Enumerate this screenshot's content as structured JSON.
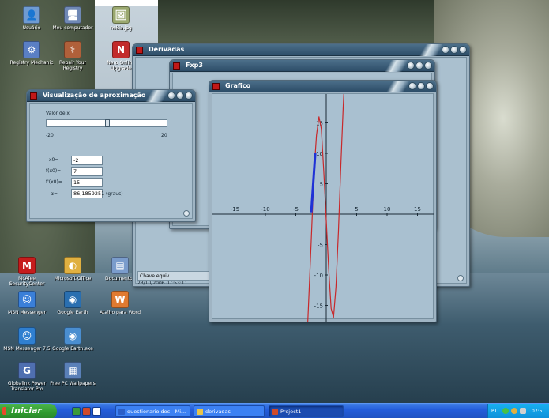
{
  "desktop": {
    "icons": [
      {
        "label": "Usuário",
        "color": "#6f9bd1",
        "glyph": "👤"
      },
      {
        "label": "Meu computador",
        "color": "#6f88b5",
        "glyph": "🖥"
      },
      {
        "label": "nokia.jpg",
        "color": "#9aa86f",
        "glyph": "🖼"
      },
      {
        "label": "Registry Mechanic",
        "color": "#5a7fc4",
        "glyph": "⚙"
      },
      {
        "label": "Repair Your Registry",
        "color": "#b0603a",
        "glyph": "⚕"
      },
      {
        "label": "Nero Online Upgrade",
        "color": "#c22a2a",
        "glyph": "N"
      },
      {
        "label": "McAfee SecurityCenter",
        "color": "#c61c1c",
        "glyph": "M"
      },
      {
        "label": "Microsoft Office",
        "color": "#e0b040",
        "glyph": "◐"
      },
      {
        "label": "Documentos",
        "color": "#7a9ccc",
        "glyph": "▤"
      },
      {
        "label": "MSN Messenger",
        "color": "#3a7fd8",
        "glyph": "☺"
      },
      {
        "label": "Google Earth",
        "color": "#2a6fb0",
        "glyph": "◉"
      },
      {
        "label": "Atalho para Word",
        "color": "#e07a30",
        "glyph": "W"
      },
      {
        "label": "MSN Messenger 7.5",
        "color": "#2f7fd0",
        "glyph": "☺"
      },
      {
        "label": "Google Earth.exe",
        "color": "#4a8ed0",
        "glyph": "◉"
      },
      {
        "label": "Globalink Power Translator Pro",
        "color": "#4f6fb0",
        "glyph": "G"
      },
      {
        "label": "Free PC Wallpapers",
        "color": "#5a80b8",
        "glyph": "▦"
      }
    ]
  },
  "windows": {
    "derivadas": {
      "title": "Derivadas"
    },
    "fxp3": {
      "title": "Fxp3"
    },
    "visualizacao": {
      "title": "Visualização de aproximação",
      "slider_caption": "Valor de x",
      "slider_min": "-20",
      "slider_max": "20",
      "slider_value": 0.5,
      "fields": [
        {
          "label": "x0=",
          "value": "-2"
        },
        {
          "label": "f(x0)=",
          "value": "7"
        },
        {
          "label": "f'(x0)=",
          "value": "15"
        },
        {
          "label": "α=",
          "value": "86,1859251"
        }
      ],
      "unit": "(graus)"
    },
    "derivadas_status": {
      "left": "Chave equiv...",
      "date": "23/10/2006 07:53:11"
    },
    "grafico": {
      "title": "Grafico",
      "chart_data": {
        "type": "line",
        "x_ticks": [
          "-15",
          "-10",
          "-5",
          "5",
          "10",
          "15"
        ],
        "y_ticks": [
          "15",
          "10",
          "5",
          "-5",
          "-10",
          "-15"
        ],
        "xlim": [
          -20,
          20
        ],
        "ylim": [
          -20,
          20
        ],
        "series": [
          {
            "kind": "curve",
            "color": "#c8282a",
            "points": [
              [
                -3.2,
                -21
              ],
              [
                -3.0,
                -17
              ],
              [
                -2.5,
                -5
              ],
              [
                -2.0,
                7
              ],
              [
                -1.6,
                13
              ],
              [
                -1.2,
                16
              ],
              [
                -0.8,
                14
              ],
              [
                -0.4,
                7
              ],
              [
                0,
                -1
              ],
              [
                0.4,
                -9
              ],
              [
                0.8,
                -15.5
              ],
              [
                1.2,
                -17
              ],
              [
                1.6,
                -12
              ],
              [
                2.0,
                -3
              ],
              [
                2.4,
                8
              ],
              [
                2.8,
                18
              ],
              [
                3.1,
                24
              ]
            ]
          },
          {
            "kind": "tangent",
            "color": "#1f32d6",
            "points": [
              [
                -2.45,
                0.3
              ],
              [
                -1.8,
                10.0
              ]
            ]
          }
        ]
      }
    }
  },
  "taskbar": {
    "start_label": "Iniciar",
    "tasks": [
      {
        "label": "questionario.doc - Mi...",
        "color": "#2b5fc8"
      },
      {
        "label": "derivadas",
        "color": "#e8c44a"
      },
      {
        "label": "Project1",
        "color": "#d04a2a"
      }
    ],
    "tray_text": "PT",
    "clock": "07:5"
  }
}
